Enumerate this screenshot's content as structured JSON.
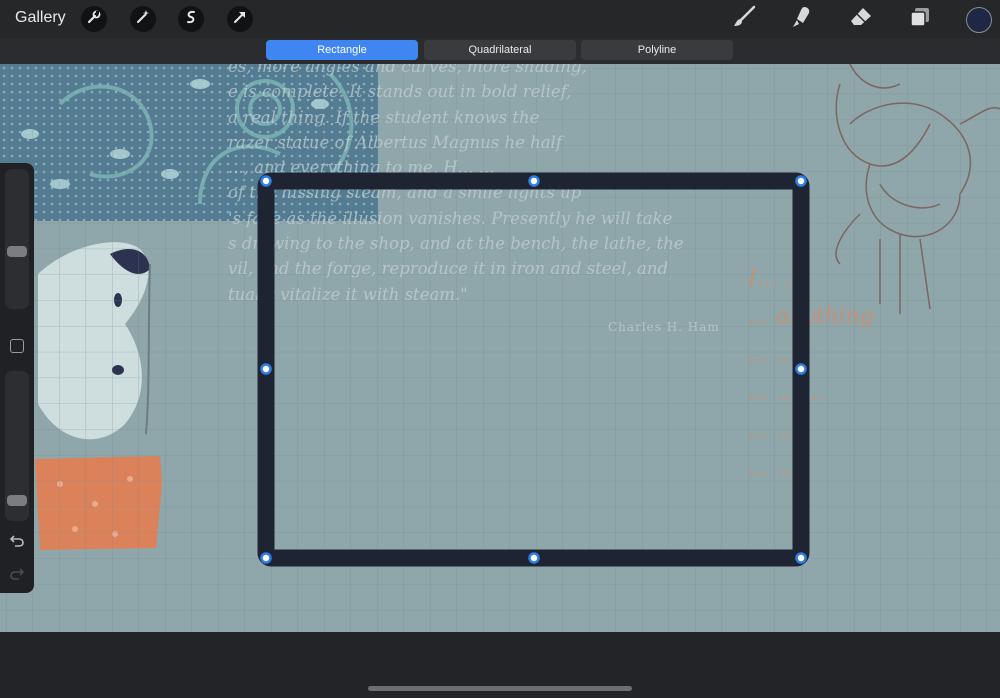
{
  "app": {
    "gallery_label": "Gallery"
  },
  "toolbar": {
    "left_tools": [
      "wrench-icon",
      "magic-wand-icon",
      "selection-icon",
      "transform-arrow-icon"
    ],
    "right_tools": [
      "brush-icon",
      "smudge-icon",
      "eraser-icon",
      "layers-icon"
    ],
    "color_swatch": "#1e2744"
  },
  "shape_modes": {
    "options": [
      "Rectangle",
      "Quadrilateral",
      "Polyline"
    ],
    "selected": "Rectangle"
  },
  "canvas": {
    "quote_text": "es, more angles and curves, more shading,\n e is complete. It stands out in bold relief,\n a real thing. If the student knows the\n razer statue of Albertus Magnus he half\n ..., and everything to me, H... ...\n of the hissing steam, and a smile lights up\n 's face as the illusion vanishes. Presently he will take\n s drawing to the shop, and at the bench, the lathe, the\n vil, and the forge, reproduce it in iron and steel, and\n tually vitalize it with steam.\"",
    "quote_author": "Charles H. Ham",
    "script_text": "I... ...\n ... anything\n ... ...\n ... ... ...\n ... ...\n ... ...",
    "accent_color": "#3f86f3"
  },
  "sidebar": {
    "brush_size_level": 0.4,
    "opacity_level": 0.1,
    "undo_icon": "undo-icon",
    "redo_icon": "redo-icon"
  }
}
